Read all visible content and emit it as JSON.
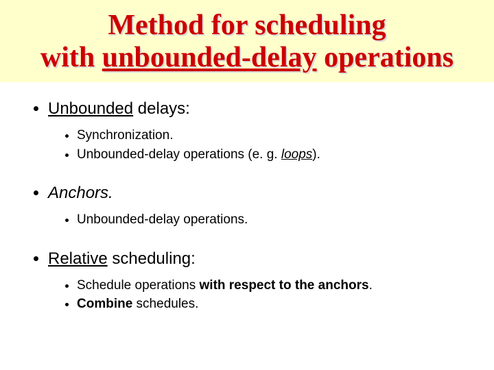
{
  "title": {
    "line1": "Method for scheduling",
    "line2_pre": "with ",
    "line2_u": "unbounded-delay",
    "line2_post": " operations"
  },
  "bullets": {
    "b1": {
      "pre": "",
      "u": "Unbounded",
      "post": " delays:",
      "sub": {
        "s1": "Synchronization.",
        "s2_pre": "Unbounded-delay operations (e. g. ",
        "s2_em": "loops",
        "s2_post": ")."
      }
    },
    "b2": {
      "em": "Anchors.",
      "sub": {
        "s1": "Unbounded-delay operations."
      }
    },
    "b3": {
      "u": "Relative",
      "post": " scheduling:",
      "sub": {
        "s1_pre": "Schedule operations ",
        "s1_b": "with respect to the anchors",
        "s1_post": ".",
        "s2_b": "Combine",
        "s2_post": " schedules."
      }
    }
  }
}
